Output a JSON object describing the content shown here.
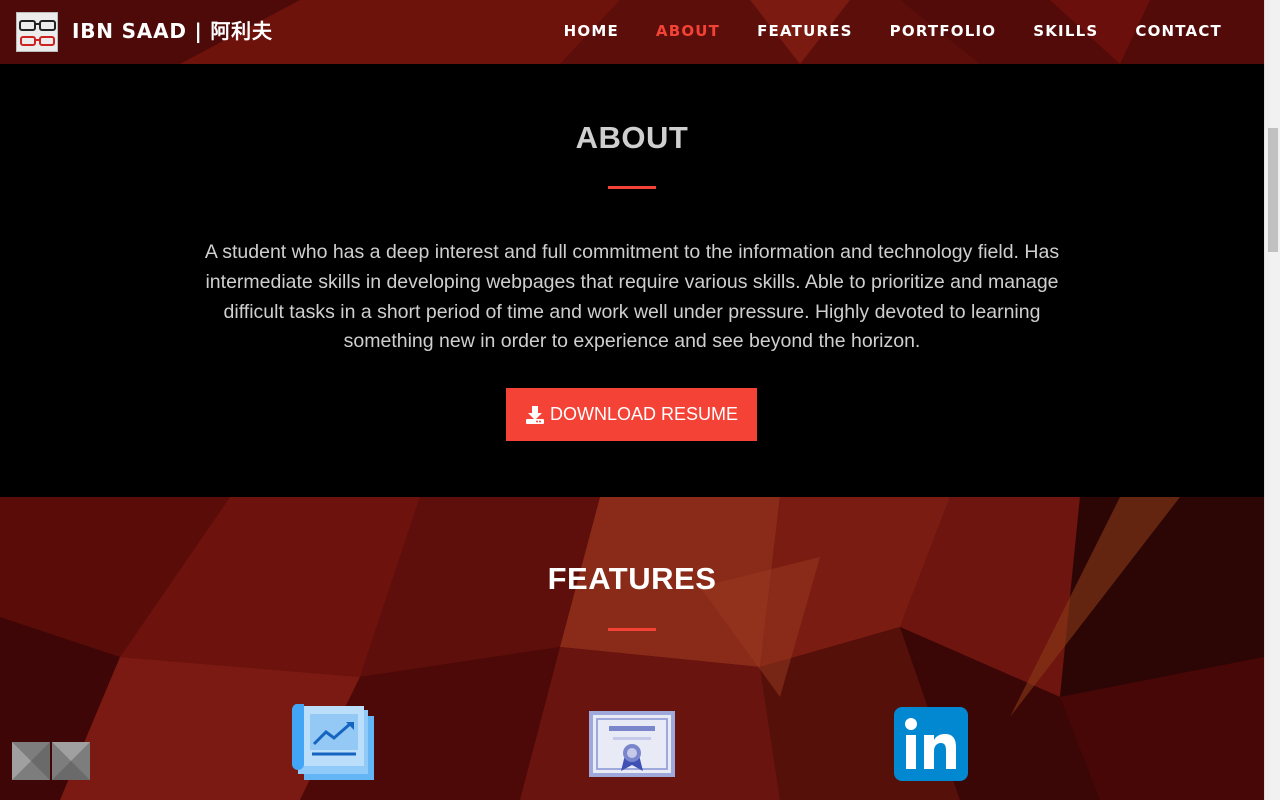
{
  "brand": {
    "name": "IBN SAAD | 阿利夫",
    "logo": "glasses-logo"
  },
  "nav": {
    "items": [
      {
        "label": "HOME",
        "active": false
      },
      {
        "label": "ABOUT",
        "active": true
      },
      {
        "label": "FEATURES",
        "active": false
      },
      {
        "label": "PORTFOLIO",
        "active": false
      },
      {
        "label": "SKILLS",
        "active": false
      },
      {
        "label": "CONTACT",
        "active": false
      }
    ]
  },
  "about": {
    "title": "ABOUT",
    "text": "A student who has a deep interest and full commitment to the information and technology field. Has intermediate skills in developing webpages that require various skills. Able to prioritize and manage difficult tasks in a short period of time and work well under pressure. Highly devoted to learning something new in order to experience and see beyond the horizon.",
    "download_label": "DOWNLOAD RESUME",
    "download_icon": "download-icon"
  },
  "features": {
    "title": "FEATURES",
    "icons": [
      "chart-document-icon",
      "certificate-icon",
      "linkedin-icon"
    ]
  },
  "colors": {
    "accent": "#f44336",
    "background_dark": "#000000",
    "background_red": "#6a0e0b"
  }
}
